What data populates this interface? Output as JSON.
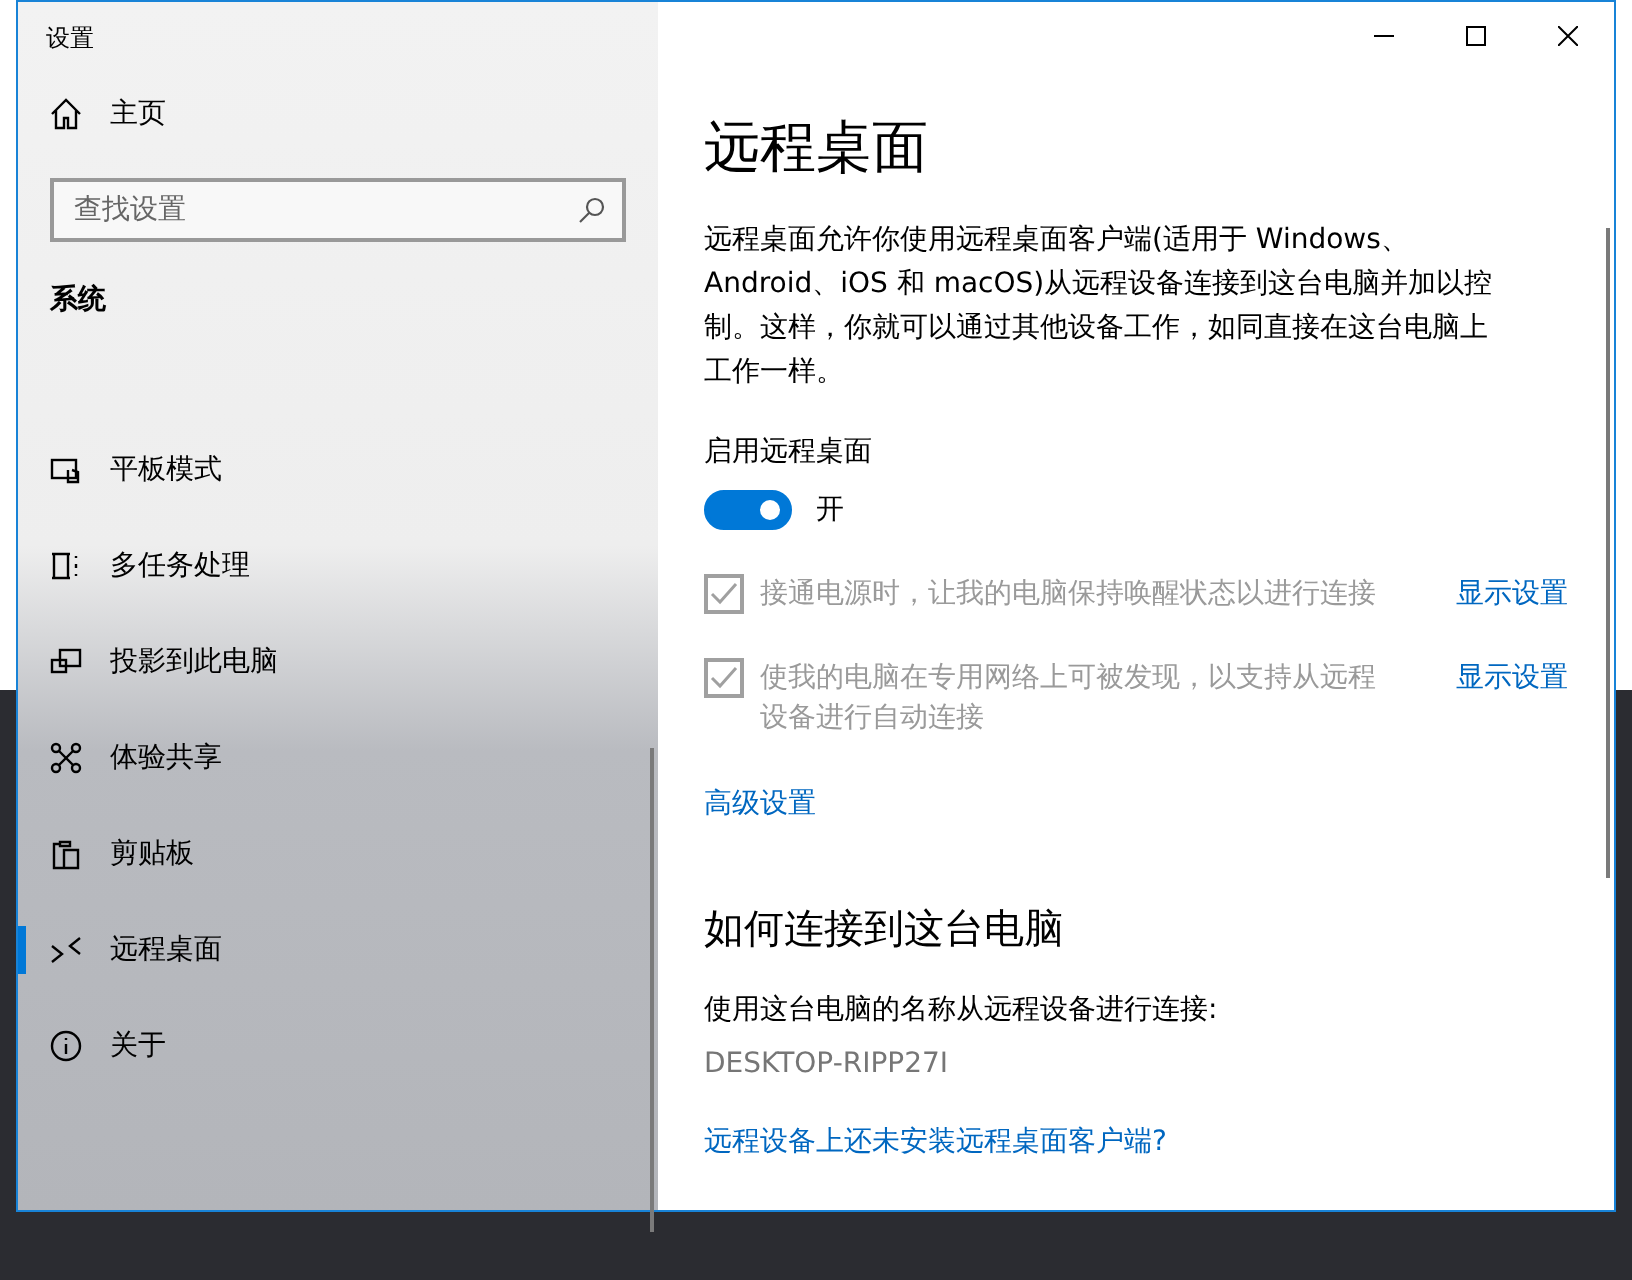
{
  "window": {
    "title": "设置"
  },
  "sidebar": {
    "home": "主页",
    "search": {
      "placeholder": "查找设置"
    },
    "section": "系统",
    "items": [
      {
        "label": "平板模式",
        "selected": false
      },
      {
        "label": "多任务处理",
        "selected": false
      },
      {
        "label": "投影到此电脑",
        "selected": false
      },
      {
        "label": "体验共享",
        "selected": false
      },
      {
        "label": "剪贴板",
        "selected": false
      },
      {
        "label": "远程桌面",
        "selected": true
      },
      {
        "label": "关于",
        "selected": false
      }
    ]
  },
  "content": {
    "title": "远程桌面",
    "description": "远程桌面允许你使用远程桌面客户端(适用于 Windows、Android、iOS 和 macOS)从远程设备连接到这台电脑并加以控制。这样，你就可以通过其他设备工作，如同直接在这台电脑上工作一样。",
    "toggle": {
      "label": "启用远程桌面",
      "on": true,
      "state_text": "开"
    },
    "options": [
      {
        "text": "接通电源时，让我的电脑保持唤醒状态以进行连接",
        "checked": true,
        "disabled": true,
        "link": "显示设置"
      },
      {
        "text": "使我的电脑在专用网络上可被发现，以支持从远程设备进行自动连接",
        "checked": true,
        "disabled": true,
        "link": "显示设置"
      }
    ],
    "advanced_link": "高级设置",
    "section_heading": "如何连接到这台电脑",
    "instruction": "使用这台电脑的名称从远程设备进行连接:",
    "pc_name": "DESKTOP-RIPP27I",
    "help_link": "远程设备上还未安装远程桌面客户端?"
  }
}
